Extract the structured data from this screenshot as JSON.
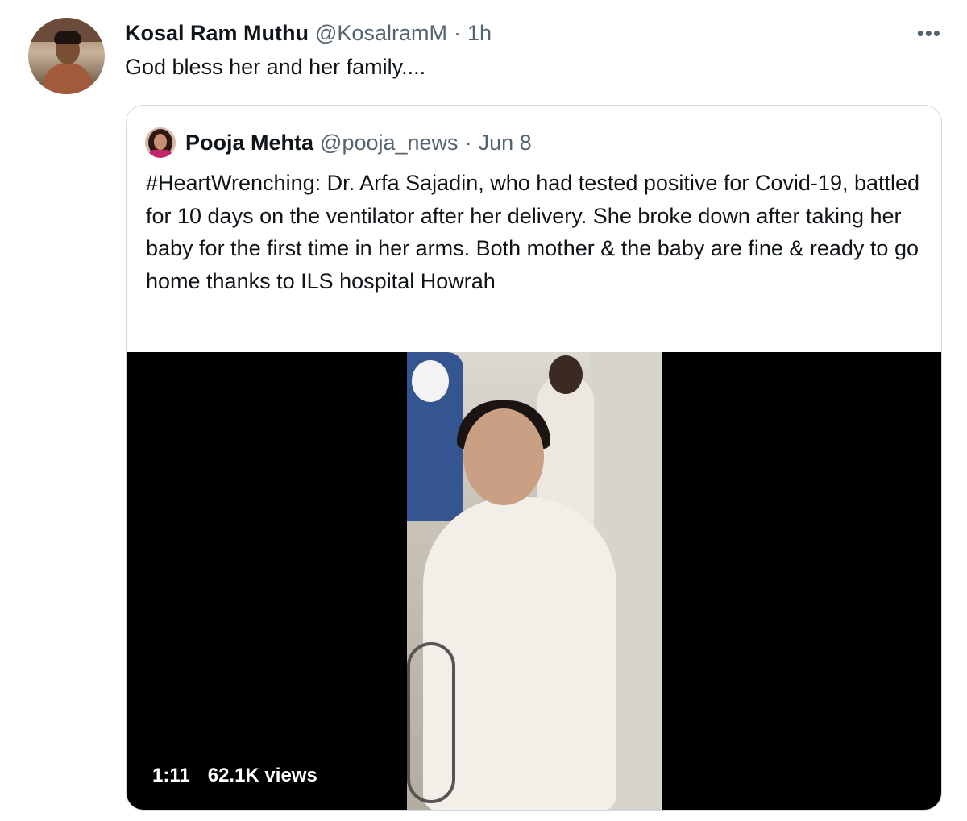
{
  "tweet": {
    "author_name": "Kosal Ram Muthu",
    "author_handle": "@KosalramM",
    "separator": "·",
    "time": "1h",
    "more_label": "•••",
    "text": "God bless her and her family...."
  },
  "quoted_tweet": {
    "author_name": "Pooja Mehta",
    "author_handle": "@pooja_news",
    "separator": "·",
    "date": "Jun 8",
    "text": "#HeartWrenching: Dr. Arfa Sajadin, who had tested positive for Covid-19, battled for 10 days on the ventilator after her delivery. She broke down after taking her baby for the first time in her arms. Both mother & the baby are fine & ready to go home thanks to ILS hospital Howrah",
    "video": {
      "duration": "1:11",
      "views": "62.1K views"
    }
  },
  "colors": {
    "text": "#0f1419",
    "muted": "#536471",
    "border": "#cfd9de",
    "video_bg": "#000000"
  },
  "icons": [
    "more-options-icon"
  ]
}
